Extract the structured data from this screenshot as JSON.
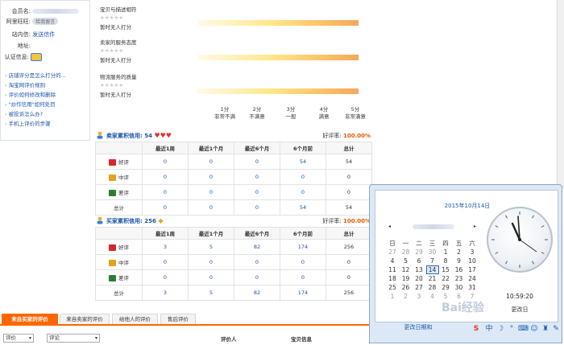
{
  "profile": {
    "member_label": "会员名:",
    "wangwang_label": "阿里旺旺:",
    "wangwang_button": "给我留言",
    "message_label": "站内信:",
    "message_link": "发送信件",
    "address_label": "地址:",
    "auth_label": "认证信息:"
  },
  "help_links": [
    "店铺评分是怎么打分的...",
    "淘宝网评价规则",
    "评价如何修改和删除",
    "\"炒作信用\"如何处罚",
    "被投诉怎么办?",
    "手机上评价的步骤"
  ],
  "scores": [
    {
      "title": "宝贝与描述相符",
      "stars": "★★★★★",
      "note": "暂时无人打分"
    },
    {
      "title": "卖家的服务态度",
      "stars": "★★★★★",
      "note": "暂时无人打分"
    },
    {
      "title": "物流服务的质量",
      "stars": "★★★★★",
      "note": "暂时无人打分"
    }
  ],
  "scale": [
    {
      "score": "1分",
      "desc": "非常不满"
    },
    {
      "score": "2分",
      "desc": "不满意"
    },
    {
      "score": "3分",
      "desc": "一般"
    },
    {
      "score": "4分",
      "desc": "满意"
    },
    {
      "score": "5分",
      "desc": "非常满意"
    }
  ],
  "seller": {
    "label": "卖家累积信用:",
    "value": "54",
    "rate_label": "好评率:",
    "rate": "100.00%",
    "columns": [
      "",
      "最近1周",
      "最近1个月",
      "最近6个月",
      "6个月前",
      "总计"
    ],
    "rows": [
      {
        "kind": "好评",
        "color": "#d9262c",
        "values": [
          "0",
          "0",
          "0",
          "54",
          "54"
        ]
      },
      {
        "kind": "中评",
        "color": "#e6a11a",
        "values": [
          "0",
          "0",
          "0",
          "0",
          "0"
        ]
      },
      {
        "kind": "差评",
        "color": "#2f7d32",
        "values": [
          "0",
          "0",
          "0",
          "0",
          "0"
        ]
      },
      {
        "kind": "总计",
        "color": "",
        "values": [
          "0",
          "0",
          "0",
          "54",
          "54"
        ]
      }
    ]
  },
  "buyer": {
    "label": "买家累积信用:",
    "value": "256",
    "rate_label": "好评率:",
    "rate": "100.00%",
    "columns": [
      "",
      "最近1周",
      "最近1个月",
      "最近6个月",
      "6个月前",
      "总计"
    ],
    "rows": [
      {
        "kind": "好评",
        "color": "#d9262c",
        "values": [
          "3",
          "5",
          "82",
          "174",
          "256"
        ]
      },
      {
        "kind": "中评",
        "color": "#e6a11a",
        "values": [
          "0",
          "0",
          "0",
          "0",
          "0"
        ]
      },
      {
        "kind": "差评",
        "color": "#2f7d32",
        "values": [
          "0",
          "0",
          "0",
          "0",
          "0"
        ]
      },
      {
        "kind": "总计",
        "color": "",
        "values": [
          "3",
          "5",
          "82",
          "174",
          "256"
        ]
      }
    ]
  },
  "tabs": [
    "来自买家的评价",
    "来自卖家的评价",
    "给他人的评价",
    "售后评价"
  ],
  "filters": {
    "select1": "评价",
    "select2": "评论",
    "col_rater": "评价人",
    "col_item": "宝贝信息"
  },
  "calendar": {
    "date_title": "2015年10月14日",
    "weekdays": [
      "日",
      "一",
      "二",
      "三",
      "四",
      "五",
      "六"
    ],
    "weeks": [
      [
        "27",
        "28",
        "29",
        "30",
        "1",
        "2",
        "3"
      ],
      [
        "4",
        "5",
        "6",
        "7",
        "8",
        "9",
        "10"
      ],
      [
        "11",
        "12",
        "13",
        "14",
        "15",
        "16",
        "17"
      ],
      [
        "18",
        "19",
        "20",
        "21",
        "22",
        "23",
        "24"
      ],
      [
        "25",
        "26",
        "27",
        "28",
        "29",
        "30",
        "31"
      ],
      [
        "1",
        "2",
        "3",
        "4",
        "5",
        "6",
        "7"
      ]
    ],
    "today": "14",
    "time": "10:59:20",
    "settings": "更改日",
    "change_link": "更改日期和"
  },
  "watermark": "Bai经验"
}
